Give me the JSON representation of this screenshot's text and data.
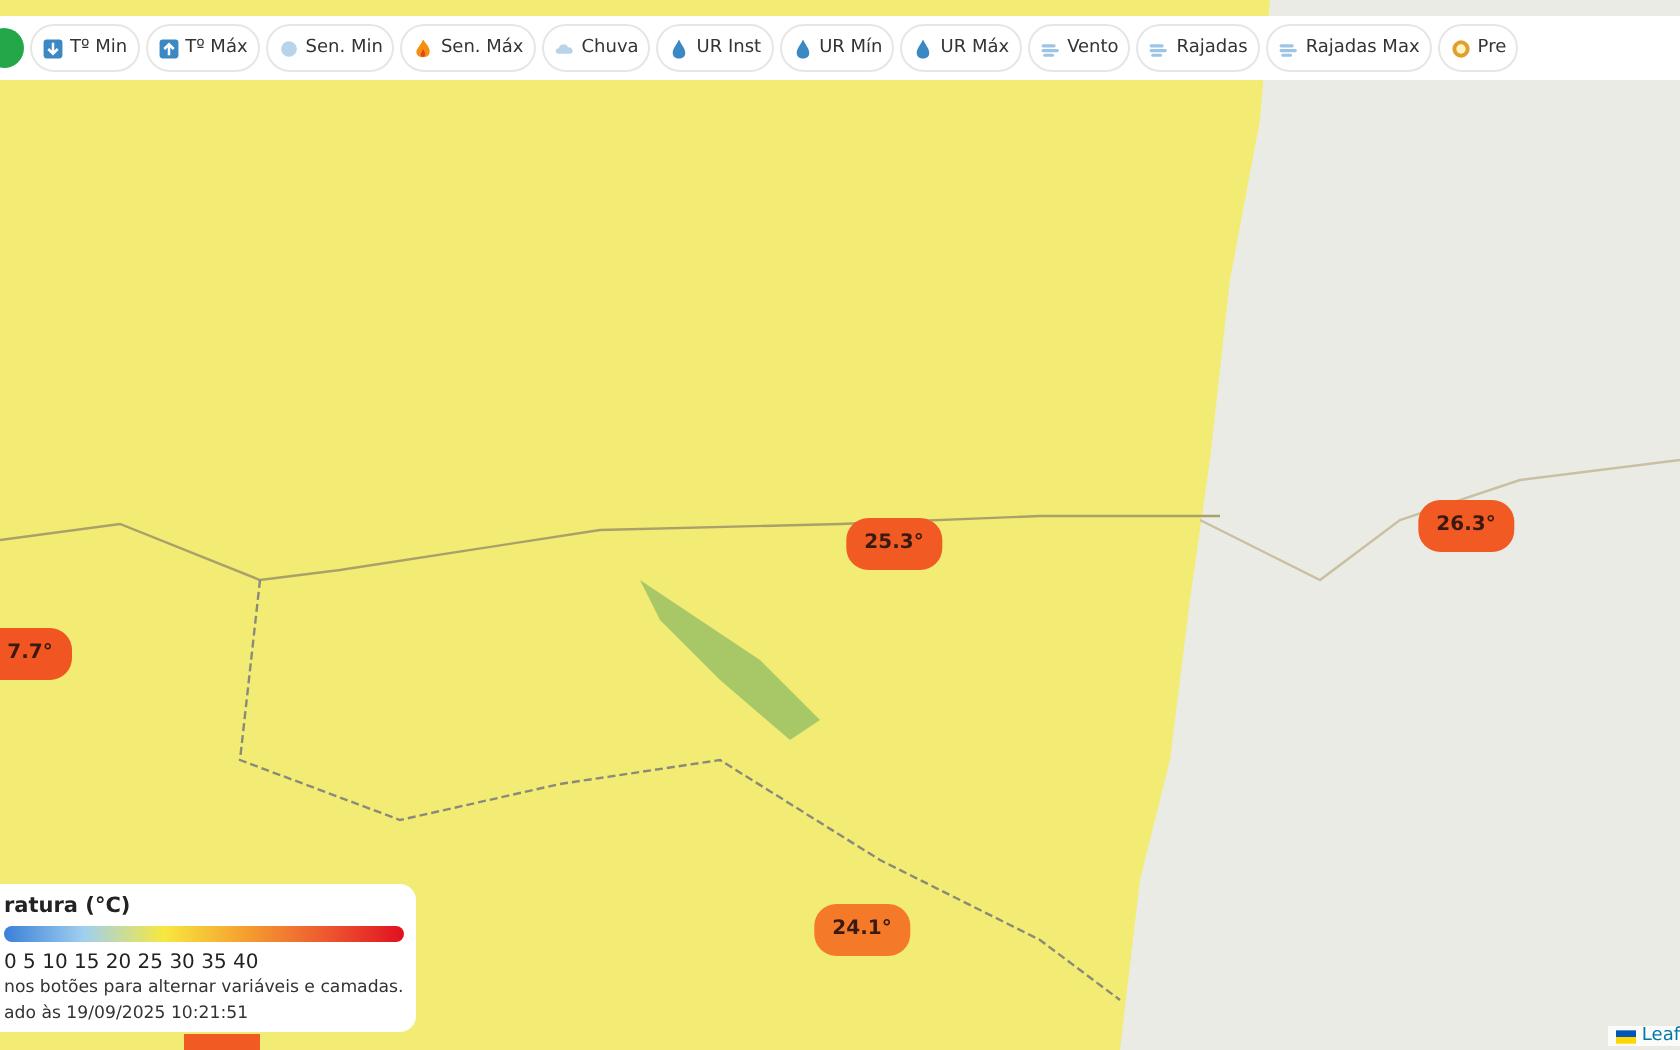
{
  "toolbar": {
    "buttons": [
      {
        "label": "Tº Min",
        "selected": false
      },
      {
        "label": "Tº Máx",
        "selected": false
      },
      {
        "label": "Sen. Min",
        "selected": false
      },
      {
        "label": "Sen. Máx",
        "selected": false
      },
      {
        "label": "Chuva",
        "selected": false
      },
      {
        "label": "UR Inst",
        "selected": false
      },
      {
        "label": "UR Mín",
        "selected": false
      },
      {
        "label": "UR Máx",
        "selected": false
      },
      {
        "label": "Vento",
        "selected": false
      },
      {
        "label": "Rajadas",
        "selected": false
      },
      {
        "label": "Rajadas Max",
        "selected": false
      },
      {
        "label": "Pre",
        "selected": false
      }
    ]
  },
  "markers": [
    {
      "label": "25.3°",
      "color": "#f15a22"
    },
    {
      "label": "26.3°",
      "color": "#f15a22"
    },
    {
      "label": "7.7°",
      "color": "#f05522"
    },
    {
      "label": "24.1°",
      "color": "#f47a2a"
    },
    {
      "color": "#f15a22"
    }
  ],
  "legend": {
    "title": "ratura (°C)",
    "scale": "0 5 10 15 20 25 30 35 40",
    "hint": "nos botões para alternar variáveis e camadas.",
    "updated": "ado às 19/09/2025 10:21:51"
  },
  "attribution": "Leaf"
}
